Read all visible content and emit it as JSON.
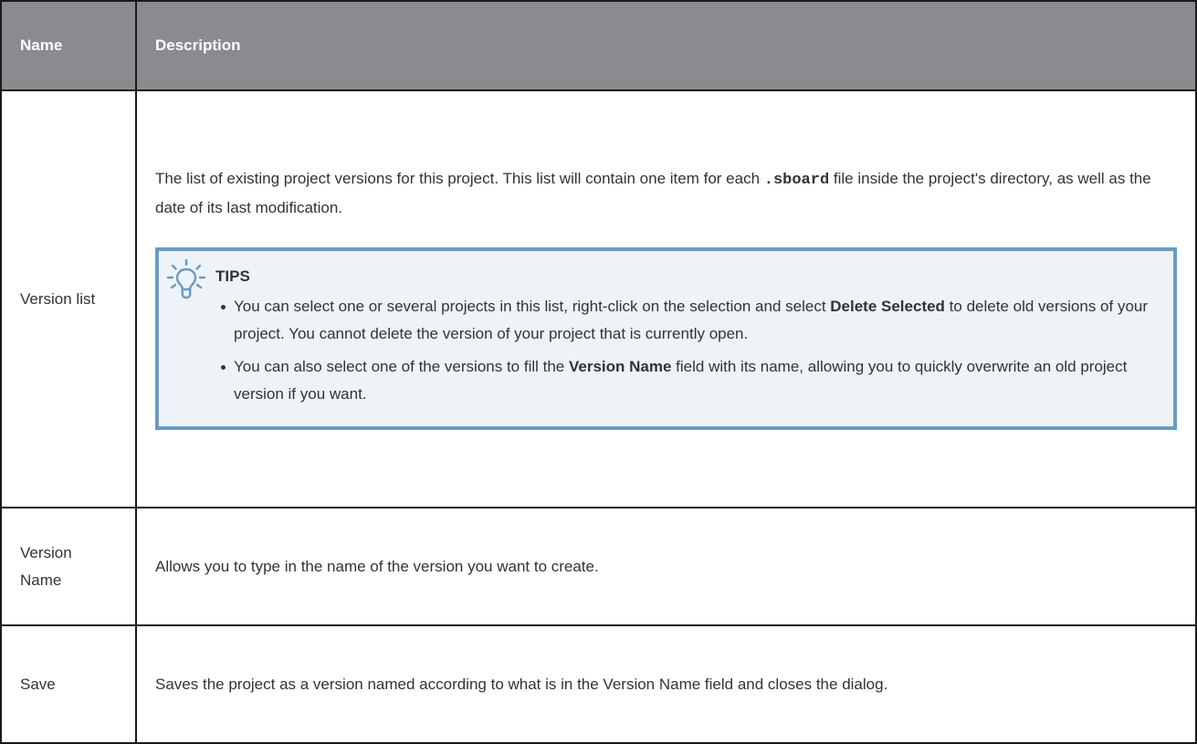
{
  "table": {
    "headers": {
      "name": "Name",
      "description": "Description"
    },
    "rows": [
      {
        "name": "Version list",
        "description": {
          "before_code": "The list of existing project versions for this project. This list will contain one item for each ",
          "code": ".sboard",
          "after_code": " file inside the project's directory, as well as the date of its last modification."
        },
        "tips": {
          "icon": "lightbulb-icon",
          "title": "TIPS",
          "items": [
            {
              "before": "You can select one or several projects in this list, right-click on the selection and select ",
              "bold": "Delete Selected",
              "after": " to delete old versions of your project. You cannot delete the version of your project that is currently open."
            },
            {
              "before": "You can also select one of the versions to fill the ",
              "bold": "Version Name",
              "after": " field with its name, allowing you to quickly overwrite an old project version if you want."
            }
          ]
        }
      },
      {
        "name": "Version Name",
        "description": "Allows you to type in the name of the version you want to create."
      },
      {
        "name": "Save",
        "description": "Saves the project as a version named according to what is in the Version Name field and closes the dialog."
      }
    ]
  },
  "colors": {
    "header_bg": "#8a8b8e",
    "tips_border": "#6b9bc2",
    "tips_bg": "#eef3f8"
  }
}
